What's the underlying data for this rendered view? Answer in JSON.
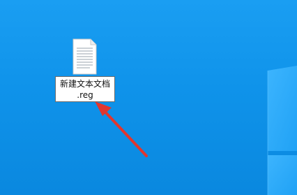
{
  "desktop": {
    "background_color": "#1296ee",
    "file": {
      "icon": "text-document-icon",
      "name_line1": "新建文本文档",
      "name_line2": ".reg"
    }
  },
  "annotation": {
    "icon": "red-arrow-icon",
    "color": "#e0362f"
  }
}
